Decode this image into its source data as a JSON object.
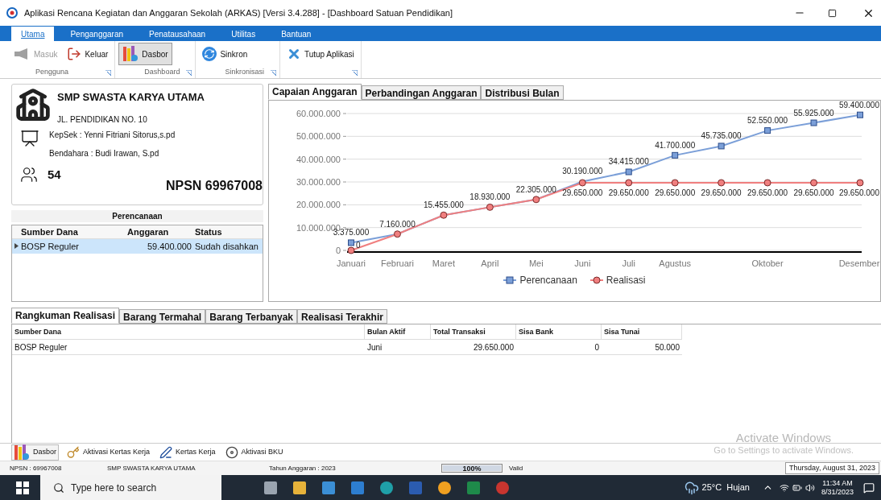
{
  "window": {
    "title": "Aplikasi Rencana Kegiatan dan Anggaran Sekolah (ARKAS) [Versi 3.4.288] - [Dashboard Satuan Pendidikan]"
  },
  "menu_tabs": [
    {
      "label": "Utama",
      "selected": true
    },
    {
      "label": "Penganggaran",
      "selected": false
    },
    {
      "label": "Penatausahaan",
      "selected": false
    },
    {
      "label": "Utilitas",
      "selected": false
    },
    {
      "label": "Bantuan",
      "selected": false
    }
  ],
  "ribbon_groups": [
    {
      "label": "Pengguna",
      "buttons": [
        {
          "kind": "masuk",
          "label": "Masuk",
          "disabled": true,
          "selected": false
        },
        {
          "kind": "keluar",
          "label": "Keluar",
          "disabled": false,
          "selected": false
        }
      ]
    },
    {
      "label": "Dashboard",
      "buttons": [
        {
          "kind": "dasbor",
          "label": "Dasbor",
          "disabled": false,
          "selected": true
        }
      ]
    },
    {
      "label": "Sinkronisasi",
      "buttons": [
        {
          "kind": "sinkron",
          "label": "Sinkron",
          "disabled": false,
          "selected": false
        }
      ]
    },
    {
      "buttons": [
        {
          "kind": "tutup",
          "label": "Tutup Aplikasi",
          "disabled": false,
          "selected": false
        }
      ]
    }
  ],
  "school": {
    "name": "SMP SWASTA KARYA UTAMA",
    "address": "JL. PENDIDIKAN NO. 10",
    "kepsek": "KepSek : Yenni Fitriani Sitorus,s.pd",
    "bendahara": "Bendahara : Budi Irawan, S.pd",
    "students": "54",
    "npsn": "NPSN 69967008"
  },
  "perencanaan": {
    "title": "Perencanaan",
    "columns": [
      "Sumber Dana",
      "Anggaran",
      "Status"
    ],
    "rows": [
      {
        "cells": [
          "BOSP Reguler",
          "59.400.000",
          "Sudah disahkan"
        ],
        "selected": true
      }
    ]
  },
  "chart_tabs": [
    {
      "label": "Capaian Anggaran",
      "selected": true
    },
    {
      "label": "Perbandingan Anggaran",
      "selected": false
    },
    {
      "label": "Distribusi Bulan",
      "selected": false
    }
  ],
  "chart_data": {
    "type": "line",
    "grid": true,
    "legend": "bottom",
    "categories": [
      "Januari",
      "Februari",
      "Maret",
      "April",
      "Mei",
      "Juni",
      "Juli",
      "Agustus",
      null,
      "Oktober",
      null,
      "Desember"
    ],
    "ylim": [
      0,
      60000000
    ],
    "yticks": [
      {
        "value": 0,
        "label": "0"
      },
      {
        "value": 10000000,
        "label": "10.000.000"
      },
      {
        "value": 20000000,
        "label": "20.000.000"
      },
      {
        "value": 30000000,
        "label": "30.000.000"
      },
      {
        "value": 40000000,
        "label": "40.000.000"
      },
      {
        "value": 50000000,
        "label": "50.000.000"
      },
      {
        "value": 60000000,
        "label": "60.000.000"
      }
    ],
    "data_labels": true,
    "series": [
      {
        "name": "Perencanaan",
        "color": "#7b9fd8",
        "marker": "square",
        "values": [
          3375000,
          7160000,
          15455000,
          18930000,
          22305000,
          30190000,
          34415000,
          41700000,
          45735000,
          52550000,
          55925000,
          59400000
        ],
        "value_labels": [
          "3.375.000",
          "7.160.000",
          "15.455.000",
          "18.930.000",
          "22.305.000",
          "30.190.000",
          "34.415.000",
          "41.700.000",
          "45.735.000",
          "52.550.000",
          "55.925.000",
          "59.400.000"
        ]
      },
      {
        "name": "Realisasi",
        "color": "#f07f7f",
        "marker": "circle",
        "values": [
          0,
          7160000,
          15455000,
          18930000,
          22305000,
          29650000,
          29650000,
          29650000,
          29650000,
          29650000,
          29650000,
          29650000
        ],
        "value_labels": [
          "0",
          null,
          null,
          null,
          null,
          "29.650.000",
          "29.650.000",
          "29.650.000",
          "29.650.000",
          "29.650.000",
          "29.650.000",
          "29.650.000"
        ]
      }
    ]
  },
  "bottom_tabs": [
    {
      "label": "Rangkuman Realisasi",
      "selected": true
    },
    {
      "label": "Barang Termahal",
      "selected": false
    },
    {
      "label": "Barang Terbanyak",
      "selected": false
    },
    {
      "label": "Realisasi Terakhir",
      "selected": false
    }
  ],
  "realisasi": {
    "columns": [
      "Sumber Dana",
      "Bulan Aktif",
      "Total Transaksi",
      "Sisa Bank",
      "Sisa Tunai"
    ],
    "rows": [
      [
        "BOSP Reguler",
        "Juni",
        "29.650.000",
        "0",
        "50.000"
      ]
    ]
  },
  "bottom_toolbar": [
    {
      "kind": "dasbor",
      "label": "Dasbor",
      "selected": true
    },
    {
      "kind": "key",
      "label": "Aktivasi Kertas Kerja",
      "selected": false
    },
    {
      "kind": "pen",
      "label": "Kertas Kerja",
      "selected": false
    },
    {
      "kind": "disc",
      "label": "Aktivasi BKU",
      "selected": false
    }
  ],
  "activation": {
    "title": "Activate Windows",
    "hint": "Go to Settings to activate Windows."
  },
  "status_bar": {
    "npsn": "NPSN : 69967008",
    "school": "SMP SWASTA KARYA UTAMA",
    "year": "Tahun Anggaran : 2023",
    "progress": {
      "label": "100%",
      "level": 1
    },
    "state": "Valid",
    "date": "Thursday, August 31, 2023"
  },
  "taskbar": {
    "search_placeholder": "Type here to search",
    "weather": "25°C  Hujan",
    "time": "11:34 AM",
    "date": "8/31/2023"
  }
}
